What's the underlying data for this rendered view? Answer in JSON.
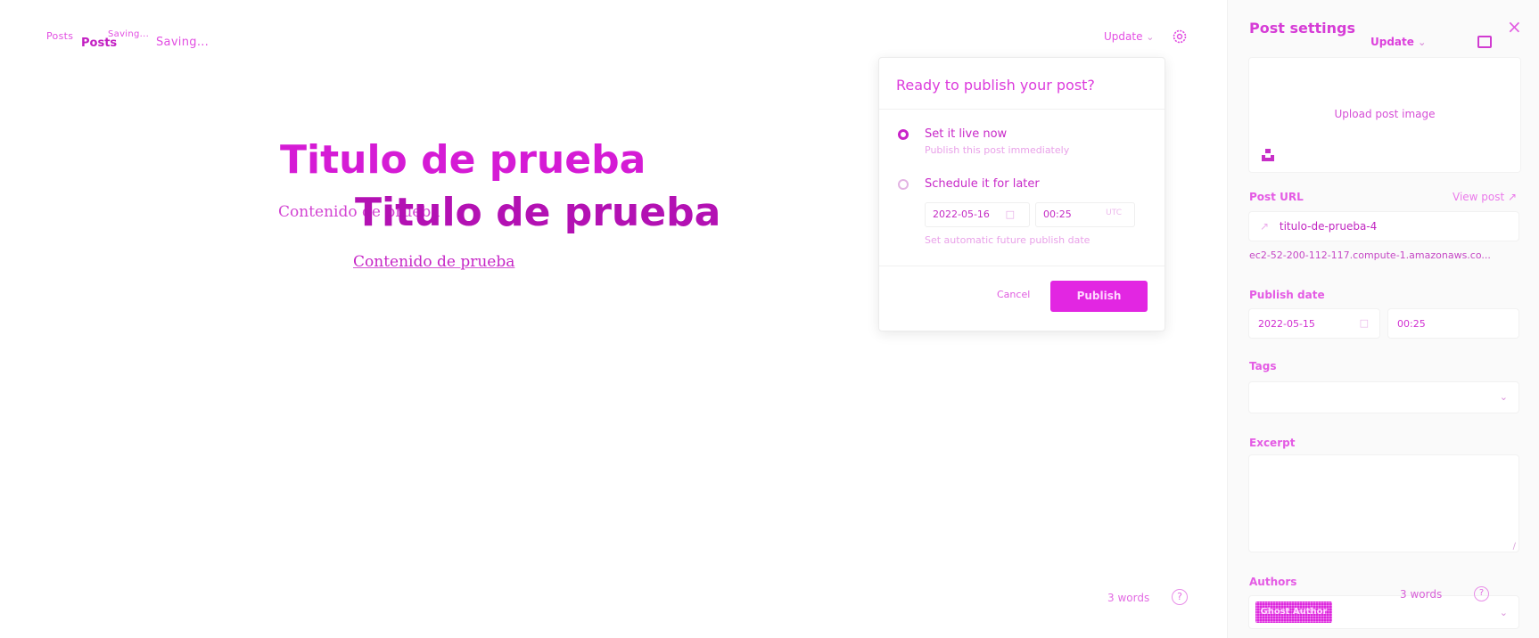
{
  "header": {
    "breadcrumb_small": "Posts",
    "breadcrumb_bold": "Posts",
    "saving_small": "Saving...",
    "saving": "Saving...",
    "update_label": "Update",
    "settings_icon": "gear-icon"
  },
  "editor": {
    "title": "Titulo de prueba",
    "title_ghost": "Titulo de prueba",
    "content": "Contenido de prueba",
    "content_ghost": "Contenido de prueba",
    "word_count": "3 words",
    "help_icon": "question-circle-icon"
  },
  "publish_popup": {
    "title": "Ready to publish your post?",
    "option_now_title": "Set it live now",
    "option_now_subtitle": "Publish this post immediately",
    "option_later_title": "Schedule it for later",
    "date_value": "2022-05-16",
    "time_value": "00:25",
    "time_suffix": "UTC",
    "schedule_hint": "Set automatic future publish date",
    "cancel_label": "Cancel",
    "publish_label": "Publish"
  },
  "sidebar": {
    "title": "Post settings",
    "update_label": "Update",
    "close_icon": "close-icon",
    "layout_icon": "sidebar-toggle-icon",
    "upload_label": "Upload post image",
    "unsplash_icon": "unsplash-icon",
    "post_url_label": "Post URL",
    "view_post_label": "View post",
    "slug_value": "titulo-de-prueba-4",
    "url_preview": "ec2-52-200-112-117.compute-1.amazonaws.co...",
    "publish_date_label": "Publish date",
    "publish_date_value": "2022-05-15",
    "publish_time_value": "00:25",
    "tags_label": "Tags",
    "excerpt_label": "Excerpt",
    "authors_label": "Authors",
    "author_chip": "Ghost Author",
    "word_count": "3 words"
  },
  "colors": {
    "accent": "#e020e0",
    "light_accent": "#e9a2e9",
    "sidebar_bg": "#fafafa"
  }
}
